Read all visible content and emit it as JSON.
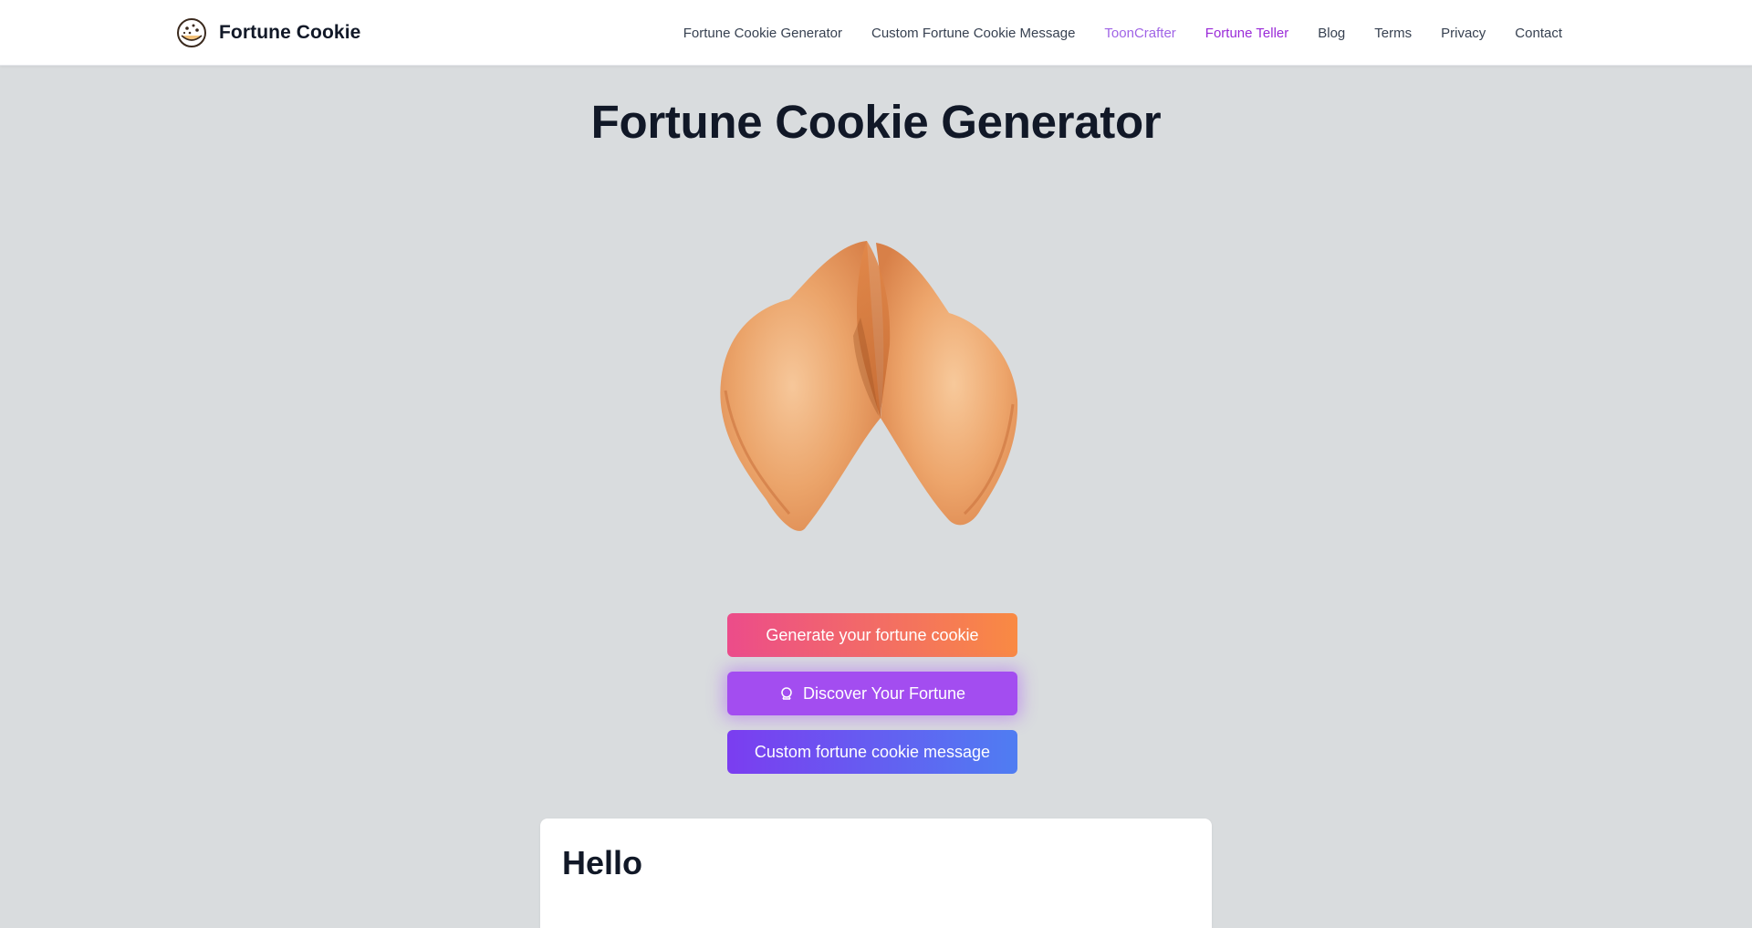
{
  "header": {
    "brand_name": "Fortune Cookie",
    "logo_icon": "cookie-icon",
    "nav": [
      {
        "label": "Fortune Cookie Generator",
        "color": "#374151"
      },
      {
        "label": "Custom Fortune Cookie Message",
        "color": "#374151"
      },
      {
        "label": "ToonCrafter",
        "color": "#a064e6"
      },
      {
        "label": "Fortune Teller",
        "color": "#9a2bd8"
      },
      {
        "label": "Blog",
        "color": "#374151"
      },
      {
        "label": "Terms",
        "color": "#374151"
      },
      {
        "label": "Privacy",
        "color": "#374151"
      },
      {
        "label": "Contact",
        "color": "#374151"
      }
    ]
  },
  "main": {
    "title": "Fortune Cookie Generator",
    "image": "fortune-cookie-image",
    "buttons": {
      "generate": "Generate your fortune cookie",
      "discover": "Discover Your Fortune",
      "discover_icon": "crystal-ball-icon",
      "custom": "Custom fortune cookie message"
    },
    "card": {
      "heading": "Hello"
    }
  },
  "colors": {
    "background": "#d9dcde",
    "generate_gradient": [
      "#ec4c8a",
      "#f98a43"
    ],
    "discover": "#a34df0",
    "custom_gradient": [
      "#7b3df0",
      "#4f7df2"
    ]
  }
}
